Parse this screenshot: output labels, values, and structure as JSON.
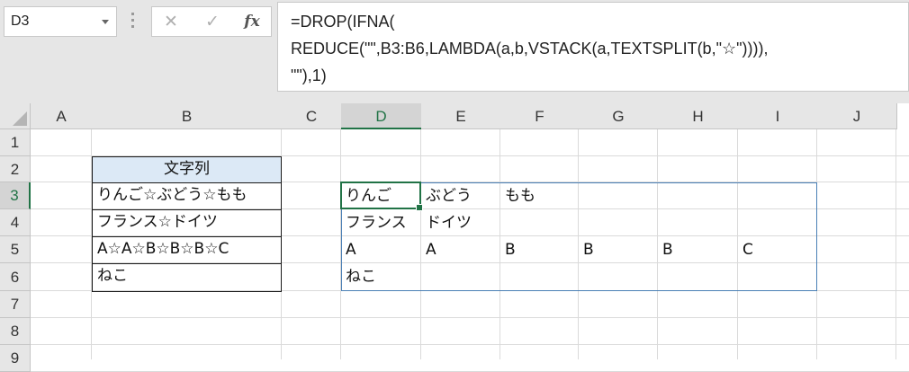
{
  "namebox": {
    "value": "D3"
  },
  "formula_bar": {
    "lines": [
      "=DROP(IFNA(",
      "REDUCE(\"\",B3:B6,LAMBDA(a,b,VSTACK(a,TEXTSPLIT(b,\"☆\")))),",
      "\"\"),1)"
    ],
    "cancel_icon": "✕",
    "enter_icon": "✓",
    "fx_label": "fx"
  },
  "columns": [
    "A",
    "B",
    "C",
    "D",
    "E",
    "F",
    "G",
    "H",
    "I",
    "J"
  ],
  "rows": [
    "1",
    "2",
    "3",
    "4",
    "5",
    "6",
    "7",
    "8",
    "9"
  ],
  "selected_column": "D",
  "selected_row": "3",
  "source_table": {
    "header": "文字列",
    "rows": [
      "りんご☆ぶどう☆もも",
      "フランス☆ドイツ",
      "A☆A☆B☆B☆B☆C",
      "ねこ"
    ]
  },
  "result": [
    [
      "りんご",
      "ぶどう",
      "もも",
      "",
      "",
      ""
    ],
    [
      "フランス",
      "ドイツ",
      "",
      "",
      "",
      ""
    ],
    [
      "A",
      "A",
      "B",
      "B",
      "B",
      "C"
    ],
    [
      "ねこ",
      "",
      "",
      "",
      "",
      ""
    ]
  ],
  "colors": {
    "accent": "#217346",
    "header_fill": "#dce9f6",
    "spill_border": "#4a7fb5"
  }
}
